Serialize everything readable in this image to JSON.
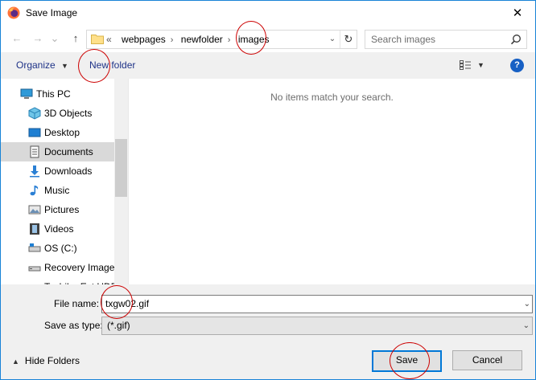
{
  "window": {
    "title": "Save Image",
    "close_glyph": "✕"
  },
  "nav": {
    "back_glyph": "←",
    "forward_glyph": "→",
    "recent_glyph": "⌄",
    "up_glyph": "↑",
    "breadcrumb_overflow": "«",
    "breadcrumbs": [
      "webpages",
      "newfolder",
      "images"
    ],
    "refresh_glyph": "↻",
    "search_placeholder": "Search images"
  },
  "toolbar": {
    "organize_label": "Organize",
    "new_folder_label": "New folder",
    "help_label": "?"
  },
  "sidebar": {
    "items": [
      {
        "label": "This PC",
        "icon": "pc-icon"
      },
      {
        "label": "3D Objects",
        "icon": "cube-icon"
      },
      {
        "label": "Desktop",
        "icon": "desktop-icon"
      },
      {
        "label": "Documents",
        "icon": "documents-icon",
        "selected": true
      },
      {
        "label": "Downloads",
        "icon": "download-icon"
      },
      {
        "label": "Music",
        "icon": "music-icon"
      },
      {
        "label": "Pictures",
        "icon": "pictures-icon"
      },
      {
        "label": "Videos",
        "icon": "videos-icon"
      },
      {
        "label": "OS (C:)",
        "icon": "drive-icon"
      },
      {
        "label": "Recovery Image",
        "icon": "drive-icon"
      },
      {
        "label": "Toshiba Ext HDD",
        "icon": "drive-icon"
      }
    ]
  },
  "content": {
    "empty_message": "No items match your search."
  },
  "form": {
    "file_name_label": "File name:",
    "file_name_value": "txgw02.gif",
    "save_as_type_label": "Save as type:",
    "save_as_type_value": "(*.gif)"
  },
  "footer": {
    "hide_folders_label": "Hide Folders",
    "save_label": "Save",
    "cancel_label": "Cancel"
  },
  "colors": {
    "accent": "#0078d7",
    "annotation": "#cc0000",
    "link_text": "#1e3287"
  }
}
